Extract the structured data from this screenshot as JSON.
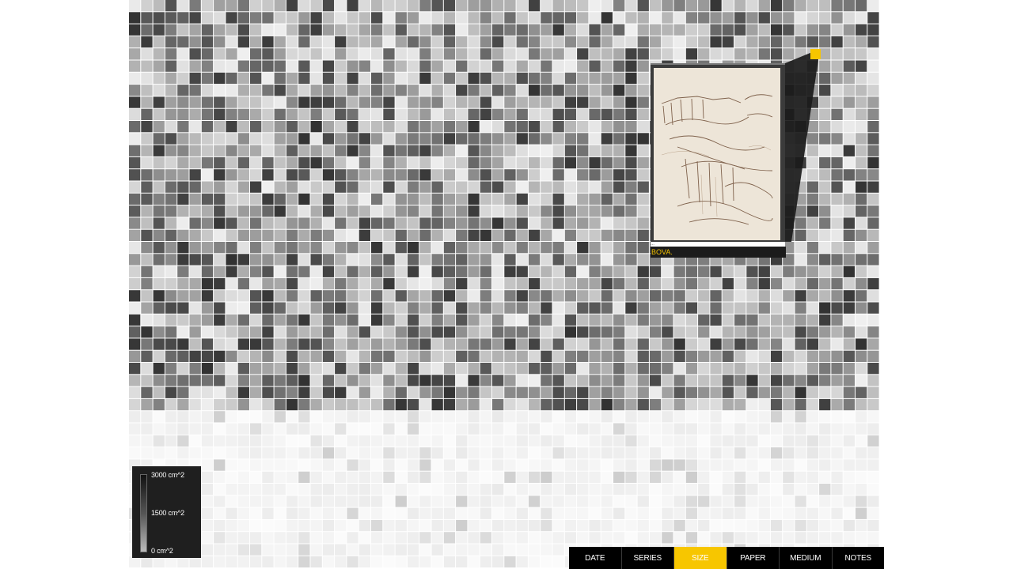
{
  "legend": {
    "max_label": "3000 cm^2",
    "mid_label": "1500 cm^2",
    "min_label": "0 cm^2"
  },
  "preview": {
    "caption_line": "…",
    "caption": "BOVA."
  },
  "tabs": [
    {
      "label": "DATE",
      "active": false
    },
    {
      "label": "SERIES",
      "active": false
    },
    {
      "label": "SIZE",
      "active": true
    },
    {
      "label": "PAPER",
      "active": false
    },
    {
      "label": "MEDIUM",
      "active": false
    },
    {
      "label": "NOTES",
      "active": false
    }
  ],
  "colors": {
    "accent": "#f7c600",
    "tab_bar": "#000000",
    "legend_bg": "#1f1f1f"
  }
}
